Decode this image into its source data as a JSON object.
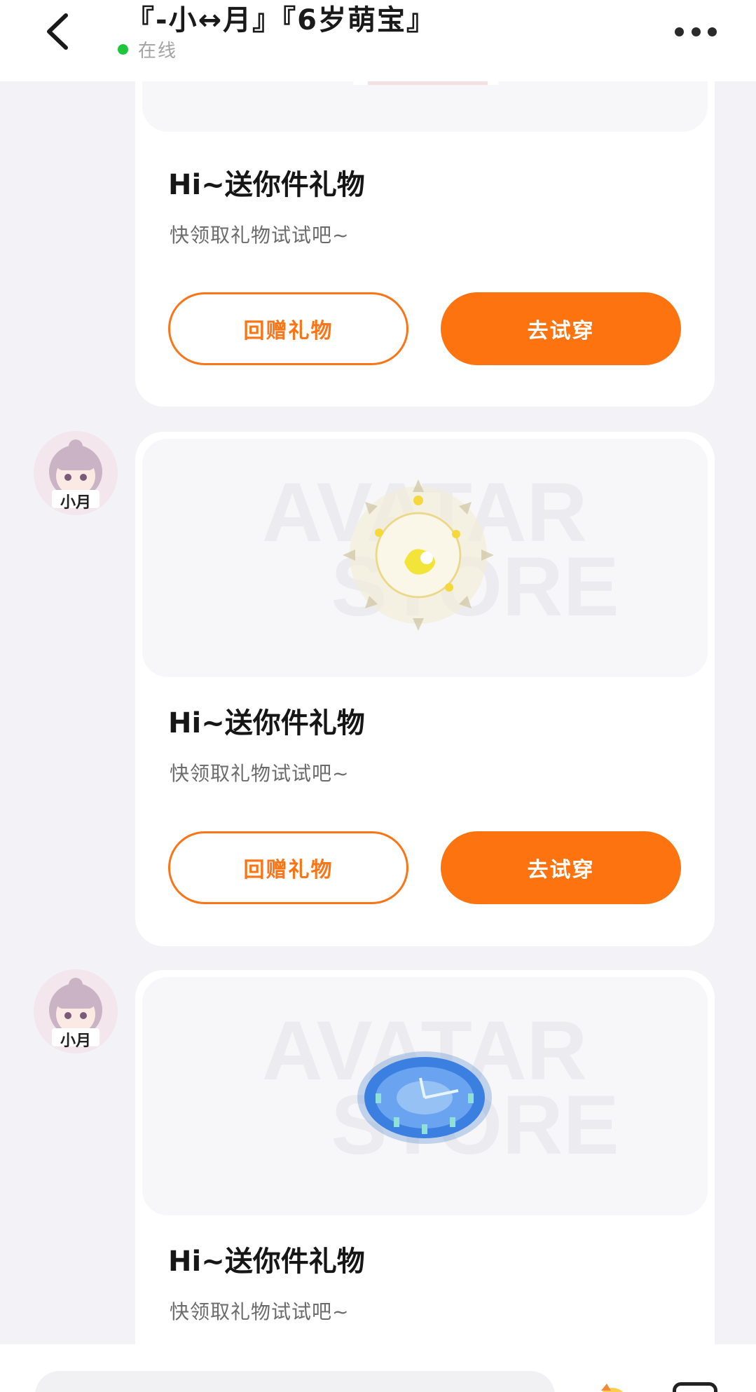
{
  "header": {
    "title": "『-小↔月』『6岁萌宝』",
    "status": "在线"
  },
  "avatars": [
    {
      "label": "小月"
    },
    {
      "label": "小月"
    }
  ],
  "cards": [
    {
      "title": "Hi~送你件礼物",
      "subtitle": "快领取礼物试试吧~",
      "return_gift_label": "回赠礼物",
      "try_on_label": "去试穿"
    },
    {
      "title": "Hi~送你件礼物",
      "subtitle": "快领取礼物试试吧~",
      "return_gift_label": "回赠礼物",
      "try_on_label": "去试穿",
      "watermark": [
        "AVATAR",
        "STORE"
      ]
    },
    {
      "title": "Hi~送你件礼物",
      "subtitle": "快领取礼物试试吧~",
      "watermark": [
        "AVATAR",
        "STORE"
      ]
    }
  ],
  "colors": {
    "accent": "#fc7310",
    "online": "#1ec63b",
    "background": "#f2f2f7"
  }
}
